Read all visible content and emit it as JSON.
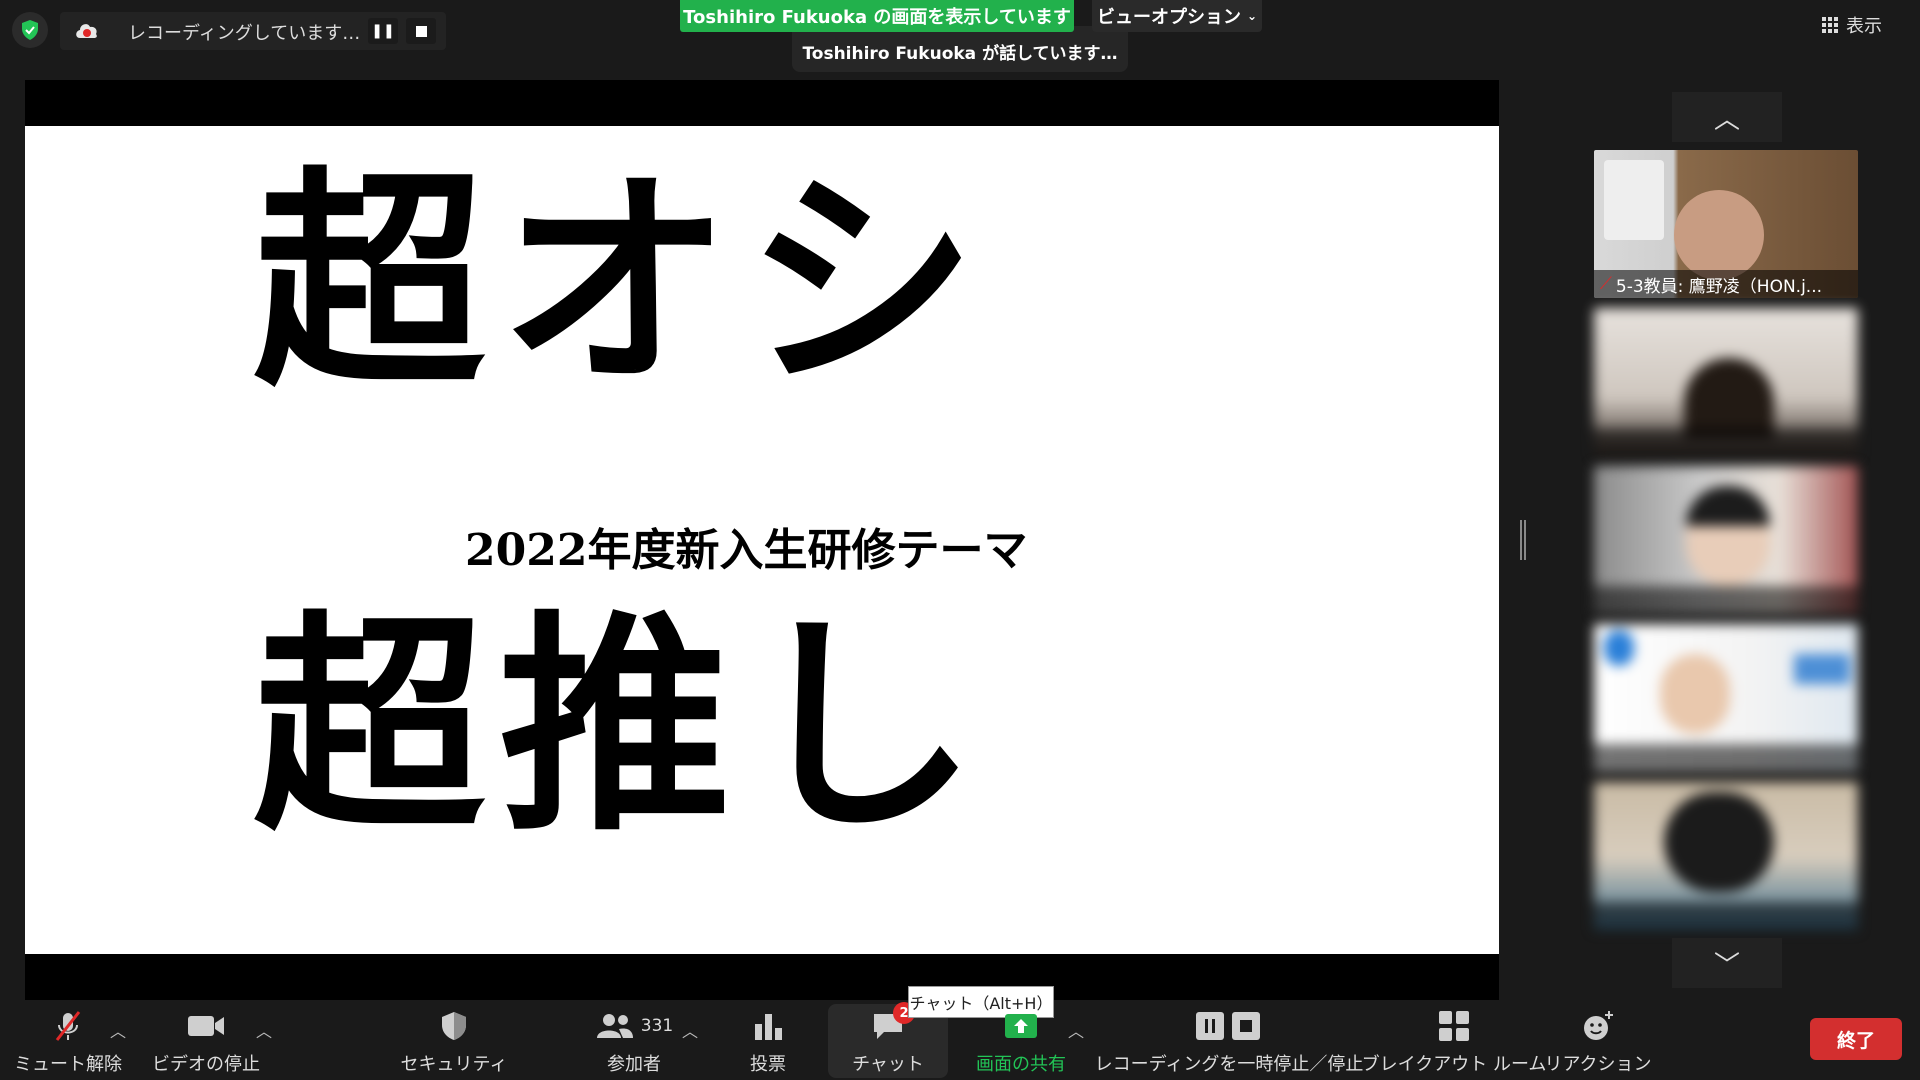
{
  "top": {
    "recording_text": "レコーディングしています…",
    "share_banner": "Toshihiro  Fukuoka の画面を表示しています",
    "speaking": "Toshihiro  Fukuoka が話しています…",
    "view_options": "ビューオプション",
    "display_label": "表示"
  },
  "slide": {
    "line1": "超オシ",
    "subtitle": "2022年度新入生研修テーマ",
    "line2": "超推し"
  },
  "gallery": {
    "tiles": [
      {
        "label": "5-3教員: 鷹野凌（HON.j..."
      },
      {
        "label": ""
      },
      {
        "label": ""
      },
      {
        "label": ""
      },
      {
        "label": ""
      }
    ]
  },
  "toolbar": {
    "unmute": "ミュート解除",
    "stop_video": "ビデオの停止",
    "security": "セキュリティ",
    "participants": "参加者",
    "participant_count": "331",
    "poll": "投票",
    "chat": "チャット",
    "chat_badge": "2",
    "chat_tooltip": "チャット（Alt+H）",
    "share": "画面の共有",
    "recording": "レコーディングを一時停止／停止",
    "breakout": "ブレイクアウト ルーム",
    "reaction": "リアクション",
    "end": "終了"
  },
  "colors": {
    "accent_green": "#22b14c",
    "end_red": "#d32f2f",
    "muted_red": "#e02828"
  }
}
